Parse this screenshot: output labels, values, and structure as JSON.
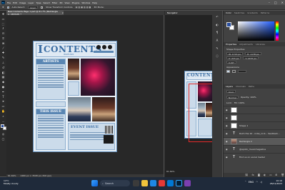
{
  "menu": {
    "app_icon": "Ps",
    "items": [
      "File",
      "Edit",
      "Image",
      "Layer",
      "Type",
      "Select",
      "Filter",
      "3D",
      "View",
      "Plugins",
      "Window",
      "Help"
    ]
  },
  "window_controls": {
    "minimize": "–",
    "maximize": "□",
    "close": "✕"
  },
  "options_bar": {
    "auto_select_label": "Auto-Select:",
    "layer_value": "Layer",
    "show_transform_label": "Show Transform Controls",
    "mode_label": "3D Mode:"
  },
  "document_tab": {
    "title": "New Contents Page 1.psd @ 61.7% (Rectangle 2, CMYK/8) *",
    "close": "×"
  },
  "magazine": {
    "title": "CONTENTS",
    "title_prefix": "I",
    "issue_label": "ISSUE 2021",
    "artists_header": "ARTISTS",
    "this_issue_header": "THIS ISSUE",
    "event_header": "EVENT ISSUE",
    "artist_items": [
      "IN CONVERSATION WITH",
      "LIVE PERFORMANCES",
      "BACKSTAGE SECRETS",
      "NEW RELEASES",
      "FESTIVAL LINEUP"
    ],
    "issue_items": [
      "FEATURED ALBUMS",
      "UPCOMING TOURS",
      "FAN STORIES",
      "INTERVIEW SPECIAL",
      "PHOTO GALLERY",
      "MUSIC REVIEWS"
    ]
  },
  "status_bar": {
    "zoom": "61.69%",
    "doc_size": "2480 px × 3508 px (300 ppi)"
  },
  "navigator": {
    "title": "Navigator",
    "zoom": "61.69%"
  },
  "right_panel": {
    "color_tabs": [
      "Color",
      "Swatches",
      "Gradients",
      "Patterns"
    ],
    "properties_tabs": [
      "Properties",
      "Adjustments",
      "Libraries"
    ],
    "shape_properties": "Shape Properties",
    "transform_w": "W: 1713 px",
    "transform_h": "H: 1178 px",
    "x": "X: 215 px",
    "y": "Y: 2157 px",
    "angle": "0.00°",
    "appearance_label": "Appearance",
    "layers_tabs": [
      "Layers",
      "Channels",
      "Paths"
    ],
    "kind_label": "Kind",
    "blend_mode": "Normal",
    "opacity_label": "Opacity: 100%",
    "lock_label": "Lock:",
    "fill_label": "Fill: 100%",
    "layers": [
      {
        "name": "",
        "thumb": "white",
        "selected": false
      },
      {
        "name": "",
        "thumb": "white",
        "selected": false
      },
      {
        "name": "Shape 1",
        "thumb": "white",
        "selected": false
      },
      {
        "name": "Ruim the 10 - indie_rock... feedback...",
        "thumb": "text",
        "selected": false
      },
      {
        "name": "Rectangle 2",
        "thumb": "white",
        "selected": true
      },
      {
        "name": "@apollo_musicmagazine",
        "thumb": "text",
        "selected": false
      },
      {
        "name": "Find us on social media!",
        "thumb": "text",
        "selected": false
      }
    ]
  },
  "taskbar": {
    "weather_temp": "14°C",
    "weather_desc": "Mostly cloudy",
    "search_placeholder": "Search",
    "time": "10:16",
    "date": "28/11/2023",
    "lang": "ENG"
  },
  "colors": {
    "fg": "#2a4fa0",
    "bg": "#ffffff",
    "accent": "#31a8ff"
  }
}
